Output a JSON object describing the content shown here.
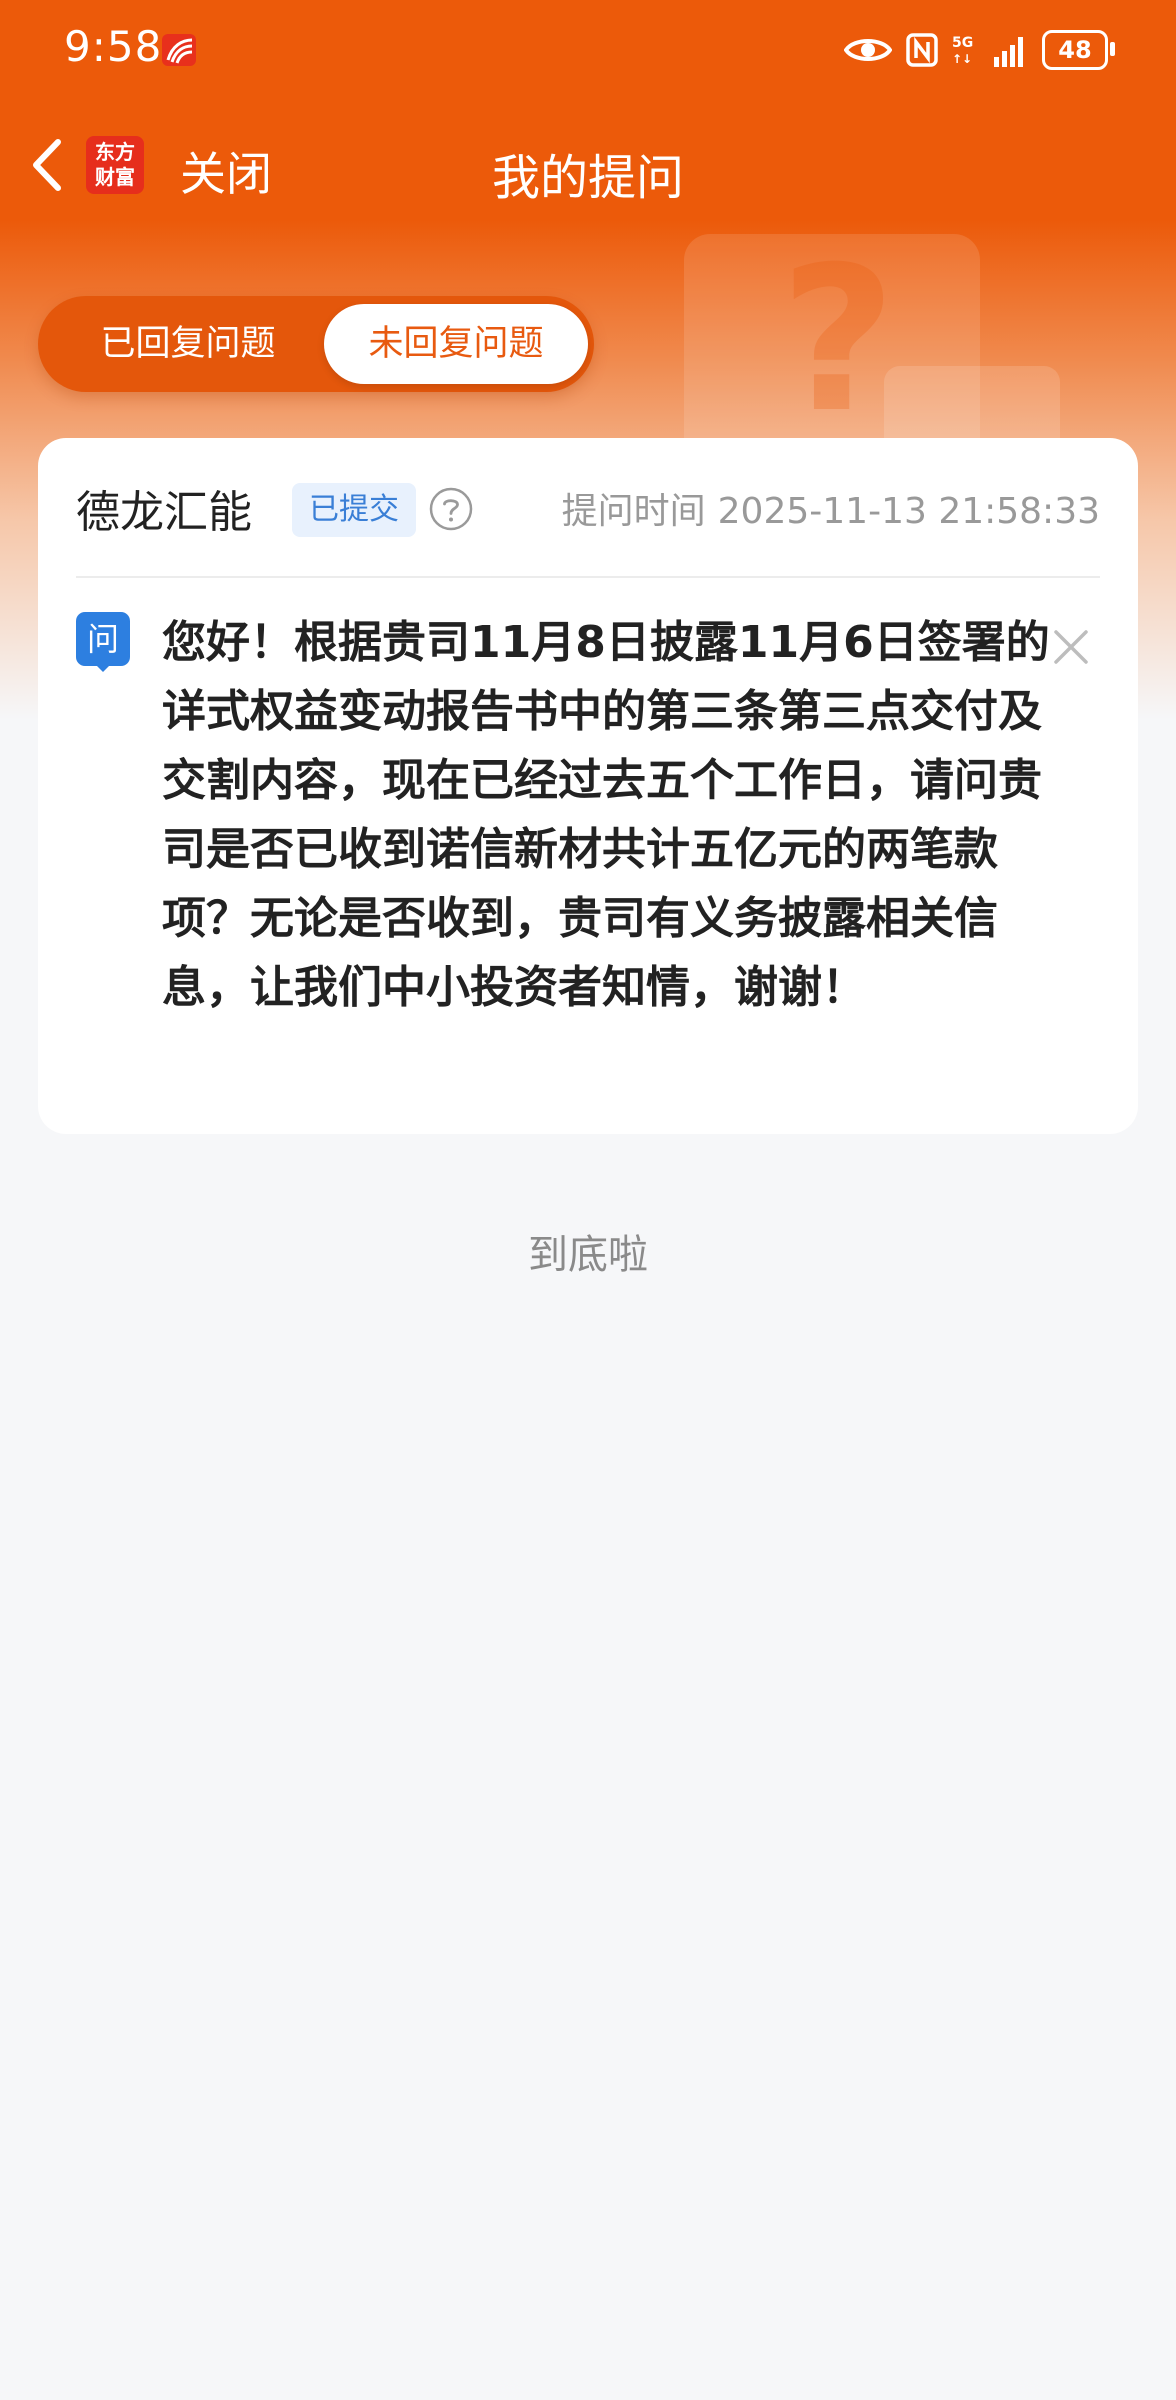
{
  "status_bar": {
    "time": "9:58",
    "network": "5G",
    "battery": "48",
    "icons": [
      "app-notification-icon",
      "eye-icon",
      "nfc-icon",
      "5g-icon",
      "signal-icon",
      "battery-icon"
    ]
  },
  "nav": {
    "brand_line1": "东方",
    "brand_line2": "财富",
    "close_label": "关闭",
    "title": "我的提问"
  },
  "tabs": [
    {
      "label": "已回复问题",
      "selected": false
    },
    {
      "label": "未回复问题",
      "selected": true
    }
  ],
  "question": {
    "company": "德龙汇能",
    "status": "已提交",
    "time_label": "提问时间",
    "time": "2025-11-13 21:58:33",
    "icon_text": "问",
    "text": "您好！根据贵司11月8日披露11月6日签署的详式权益变动报告书中的第三条第三点交付及交割内容，现在已经过去五个工作日，请问贵司是否已收到诺信新材共计五亿元的两笔款项？无论是否收到，贵司有义务披露相关信息，让我们中小投资者知情，谢谢！"
  },
  "footer": "到底啦",
  "colors": {
    "brand_orange": "#ec5a0a",
    "tab_selected_text": "#e85a10",
    "badge_blue": "#3a7fd6",
    "question_icon": "#2d7fe0"
  }
}
